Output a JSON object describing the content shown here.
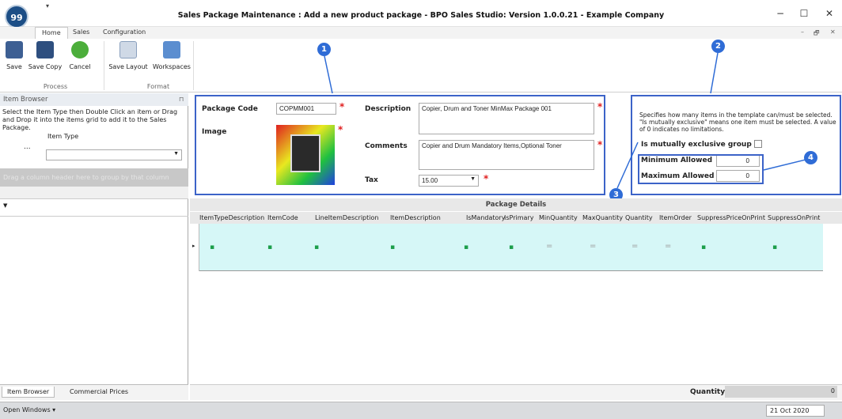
{
  "window": {
    "title": "Sales Package Maintenance : Add a new product package - BPO Sales Studio: Version 1.0.0.21 - Example Company",
    "logo": "99",
    "controls": [
      "−",
      "☐",
      "✕"
    ],
    "ribbon_controls": [
      "–",
      "🗗",
      "✕"
    ]
  },
  "ribbon": {
    "tabs": [
      "Home",
      "Sales",
      "Configuration"
    ],
    "buttons": [
      "Save",
      "Save Copy",
      "Cancel",
      "Save Layout",
      "Workspaces"
    ],
    "groups": [
      "Process",
      "Format"
    ]
  },
  "left": {
    "header": "Item Browser",
    "pin": "⊓",
    "notice": "Select the Item Type then Double Click an item or Drag and Drop it into the items grid to add it to the Sales Package.",
    "item_type_label": "Item Type",
    "ellipsis": "...",
    "group_hint": "Drag a column header here to group by that column",
    "filter_mark": "▼",
    "tabs": [
      "Item Browser",
      "Commercial Prices"
    ]
  },
  "form": {
    "package_code_label": "Package Code",
    "package_code": "COPMM001",
    "image_label": "Image",
    "description_label": "Description",
    "description": "Copier, Drum and Toner MinMax Package 001",
    "comments_label": "Comments",
    "comments": "Copier and Drum Mandatory Items,Optional Toner",
    "tax_label": "Tax",
    "tax": "15.00"
  },
  "group_panel": {
    "info": "Specifies how many items in the template can/must be selected. \"Is mutually exclusive\" means one item must be selected. A value of 0 indicates no limitations.",
    "exclusive_label": "Is mutually exclusive group",
    "min_label": "Minimum Allowed",
    "min_value": "0",
    "max_label": "Maximum Allowed",
    "max_value": "0"
  },
  "details": {
    "title": "Package Details",
    "columns": [
      "ItemTypeDescription",
      "ItemCode",
      "LineItemDescription",
      "ItemDescription",
      "IsMandatory",
      "IsPrimary",
      "MinQuantity",
      "MaxQuantity",
      "Quantity",
      "ItemOrder",
      "SuppressPriceOnPrint",
      "SuppressOnPrint"
    ],
    "quantity_label": "Quantity",
    "quantity_value": "0"
  },
  "callouts": [
    "1",
    "2",
    "3",
    "4"
  ],
  "status": {
    "open_windows": "Open Windows ▾",
    "date": "21 Oct 2020"
  }
}
